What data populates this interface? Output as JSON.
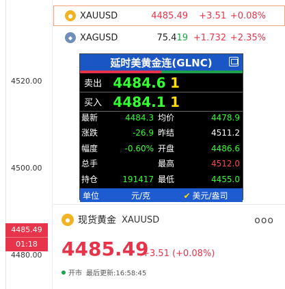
{
  "axis": {
    "ticks": [
      "4520.00",
      "4500.00",
      "4480.00"
    ],
    "current_price": "4485.49",
    "countdown": "01:18"
  },
  "watchlist": [
    {
      "symbol": "XAUUSD",
      "price": "4485.49",
      "change": "+3.51",
      "pct": "+0.08%",
      "icon": "gold-coin-icon",
      "selected": true
    },
    {
      "symbol": "XAGUSD",
      "price_main": "75.4",
      "price_tail": "19",
      "change": "+1.732",
      "pct": "+2.35%",
      "icon": "silver-coin-icon",
      "selected": false
    }
  ],
  "quote_panel": {
    "title": "延时美黄金连(GLNC)",
    "sell_label": "卖出",
    "sell_price": "4484.6",
    "sell_qty": "1",
    "buy_label": "买入",
    "buy_price": "4484.1",
    "buy_qty": "1",
    "rows": [
      {
        "k1": "最新",
        "v1": "4484.3",
        "k2": "均价",
        "v2": "4478.9"
      },
      {
        "k1": "涨跌",
        "v1": "-26.9",
        "k2": "昨结",
        "v2": "4511.2"
      },
      {
        "k1": "幅度",
        "v1": "-0.60%",
        "k2": "开盘",
        "v2": "4486.6"
      },
      {
        "k1": "总手",
        "v1": "",
        "k2": "最高",
        "v2": "4512.0"
      },
      {
        "k1": "持仓",
        "v1": "191417",
        "k2": "最低",
        "v2": "4455.0"
      }
    ],
    "footer": {
      "unit_label": "单位",
      "unit_cny": "元/克",
      "unit_usd": "美元/盎司"
    }
  },
  "card": {
    "name": "现货黄金",
    "symbol": "XAUUSD",
    "price": "4485.49",
    "change": "+3.51 (+0.08%)",
    "status": "开市",
    "updated": "最后更新:16:58:45",
    "more": "ooo"
  },
  "colors": {
    "up": "#e8344a",
    "down_green": "#1da14a",
    "accent_blue": "#1a56c4"
  }
}
